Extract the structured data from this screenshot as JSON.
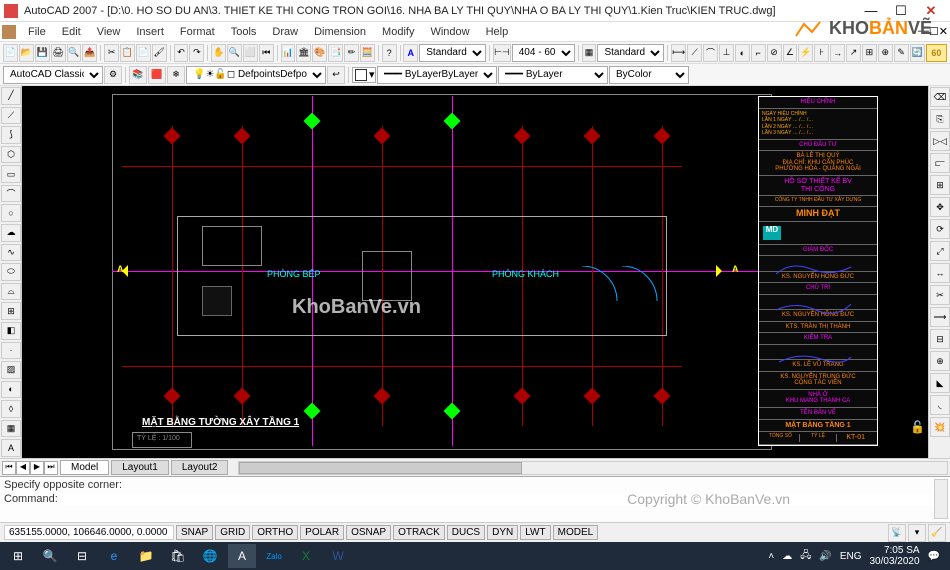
{
  "title": "AutoCAD 2007 - [D:\\0. HO SO DU AN\\3. THIET KE THI CONG TRON GOI\\16. NHA BA LY THI QUY\\NHA O BA LY THI QUY\\1.Kien Truc\\KIEN TRUC.dwg]",
  "menu": [
    "File",
    "Edit",
    "View",
    "Insert",
    "Format",
    "Tools",
    "Draw",
    "Dimension",
    "Modify",
    "Window",
    "Help"
  ],
  "toolbar2": {
    "layer_style": "AutoCAD Classic",
    "layer_name": "Defpoints",
    "layer_color": "#ffffff",
    "line_layer": "ByLayer",
    "line_color": "ByColor",
    "text_style": "Standard",
    "dim_style": "404 - 60",
    "table_style": "Standard"
  },
  "drawing": {
    "title": "MẶT BẰNG TƯỜNG XÂY TẦNG 1",
    "rooms": [
      "PHÒNG BẾP",
      "PHÒNG KHÁCH"
    ],
    "watermark": "KhoBanVe.vn",
    "tyle": "TỶ LỆ : 1/100"
  },
  "titleblock": {
    "header": "HIỆU CHỈNH",
    "rows": [
      "NGÀY HIỆU CHỈNH",
      "LẦN 1 NGÀY … /… /…",
      "LẦN 2 NGÀY … /… /…",
      "LẦN 3 NGÀY … /… /…"
    ],
    "owner_h": "CHỦ ĐẦU TƯ",
    "owner": "BÀ LÊ THỊ QUÝ\nĐỊA CHỈ: KHU CẦN PHÚC\nPHƯỜNG HÒA - QUẢNG NGÃI",
    "project": "HỒ SƠ THIẾT KẾ BV\nTHI CÔNG",
    "company_h": "CÔNG TY TNHH ĐẦU TƯ XÂY DỰNG",
    "company": "MINH ĐẠT",
    "role1": "GIÁM ĐỐC",
    "sig1": "KS. NGUYỄN HỒNG ĐỨC",
    "role2": "CHỦ TRÌ",
    "sig2": "KS. NGUYỄN HỒNG ĐỨC",
    "role3": "KTS. TRẦN THỊ THÀNH",
    "role4": "KIỂM TRA",
    "sig4": "KS. LÊ VŨ TRANG",
    "role5": "KS. NGUYỄN TRUNG ĐỨC\nCỘNG TÁC VIÊN",
    "project2": "NHÀ Ở\nKHU MANG THANH CA",
    "sheet_name": "TÊN BẢN VẼ",
    "sheet": "MẶT BẰNG TẦNG 1",
    "footer_l": "TỔNG SỐ",
    "footer_r": "TỶ LỆ",
    "code": "KT-01"
  },
  "logo": {
    "part1": "KHO",
    "part2": "BẢN",
    "part3": "VẼ"
  },
  "tabs": [
    "Model",
    "Layout1",
    "Layout2"
  ],
  "command": {
    "lines": [
      "Specify opposite corner:"
    ],
    "prompt": "Command:",
    "value": "",
    "watermark": "Copyright © KhoBanVe.vn"
  },
  "status": {
    "coords": "635155.0000, 106646.0000, 0.0000",
    "buttons": [
      "SNAP",
      "GRID",
      "ORTHO",
      "POLAR",
      "OSNAP",
      "OTRACK",
      "DUCS",
      "DYN",
      "LWT",
      "MODEL"
    ]
  },
  "tray": {
    "lang": "ENG",
    "time": "7:05 SA",
    "date": "30/03/2020"
  }
}
